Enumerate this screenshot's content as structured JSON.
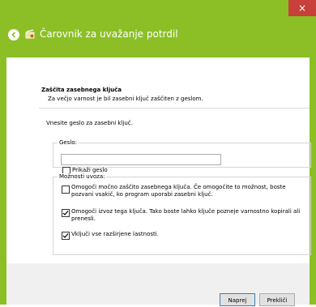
{
  "window": {
    "close_glyph": "×",
    "accent_color": "#8cbf26"
  },
  "header": {
    "title": "Čarovnik za uvažanje potrdil"
  },
  "page": {
    "section_title": "Zaščita zasebnega ključa",
    "section_subtitle": "Za večjo varnost je bil zasebni ključ zaščiten z geslom.",
    "instruction": "Vnesite geslo za zasebni ključ.",
    "password_group": {
      "label": "Geslo:",
      "value": "",
      "show_password_label": "Prikaži geslo",
      "show_password_checked": false
    },
    "import_options": {
      "label": "Možnosti uvoza:",
      "items": [
        {
          "label": "Omogoči močno zaščito zasebnega ključa. Če omogočite to možnost, boste pozvani vsakič, ko program uporabi zasebni ključ.",
          "checked": false
        },
        {
          "label": "Omogoči izvoz tega ključa. Tako boste lahko ključe pozneje varnostno kopirali ali prenesli.",
          "checked": true
        },
        {
          "label": "Vključi vse razširjene lastnosti.",
          "checked": true
        }
      ]
    }
  },
  "footer": {
    "next_label": "Naprej",
    "cancel_label": "Prekliči"
  },
  "icons": {
    "back": "back-arrow-icon",
    "wizard": "certificate-icon",
    "check": "checkmark-icon"
  }
}
